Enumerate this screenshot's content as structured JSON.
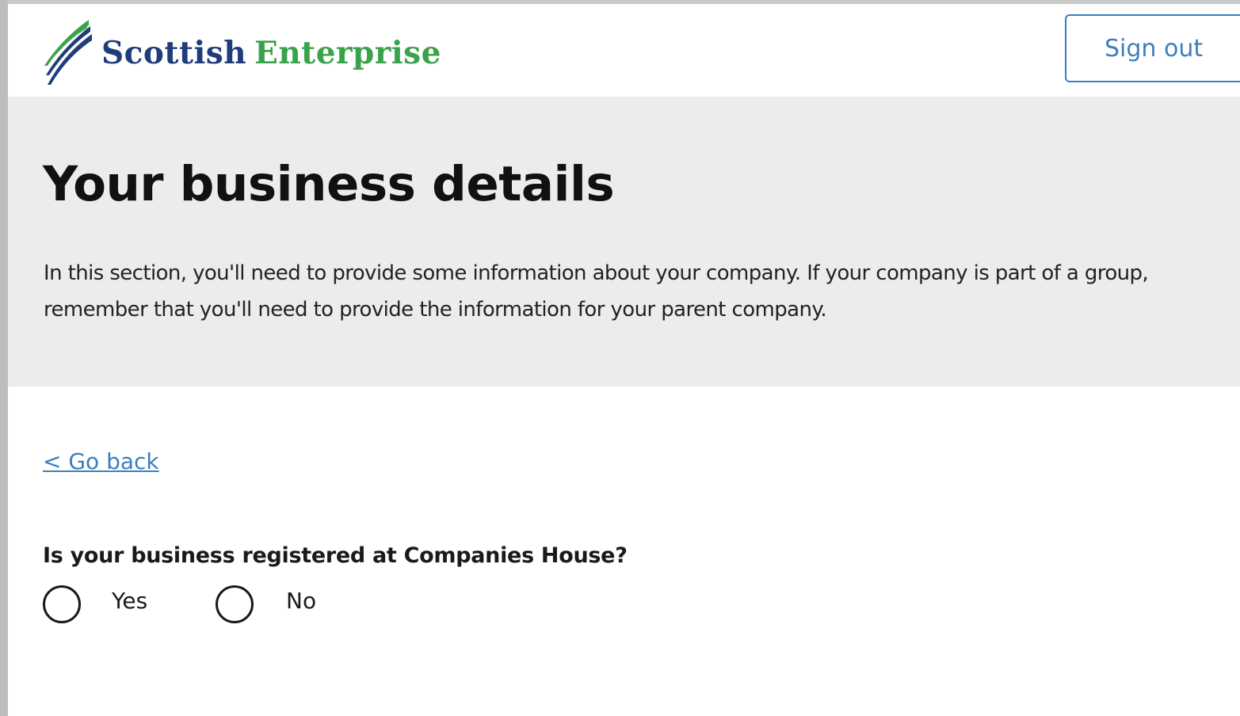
{
  "header": {
    "logo": {
      "word1": "Scottish",
      "word2": "Enterprise",
      "icon": "scottish-enterprise-swoosh-logo",
      "colors": {
        "primary": "#1f3d7a",
        "secondary": "#3aa24a"
      }
    },
    "sign_out_label": "Sign out"
  },
  "banner": {
    "title": "Your business details",
    "intro": "In this section, you'll need to provide some information about your company. If your company is part of a group, remember that you'll need to provide the information for your parent company.",
    "background": "#ececec"
  },
  "main": {
    "go_back_label": "< Go back",
    "question": "Is your business registered at Companies House?",
    "options": [
      {
        "label": "Yes",
        "selected": false
      },
      {
        "label": "No",
        "selected": false
      }
    ]
  },
  "colors": {
    "link": "#3b7fbf",
    "text": "#1a1a1a"
  }
}
